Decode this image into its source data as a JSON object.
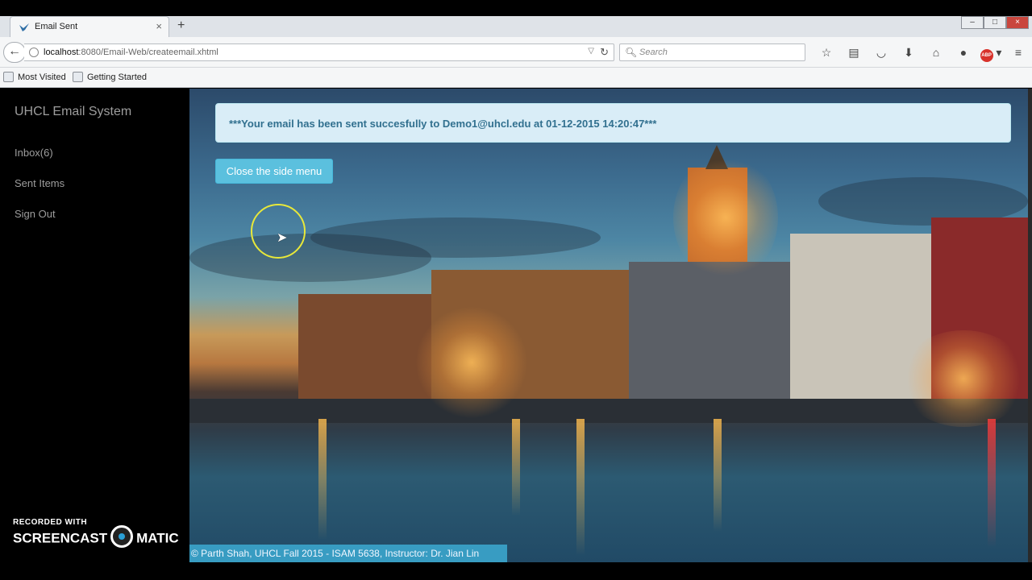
{
  "browser": {
    "tab_title": "Email Sent",
    "tab_close": "×",
    "new_tab": "+",
    "url_host": "localhost",
    "url_rest": ":8080/Email-Web/createemail.xhtml",
    "search_placeholder": "Search",
    "bookmarks": [
      "Most Visited",
      "Getting Started"
    ],
    "icons": [
      "back-icon",
      "star-icon",
      "reading-list-icon",
      "pocket-icon",
      "download-icon",
      "home-icon",
      "chat-icon",
      "adblock-icon",
      "menu-icon"
    ],
    "abp_label": "ABP"
  },
  "sidebar": {
    "brand": "UHCL Email System",
    "items": [
      "Inbox(6)",
      "Sent Items",
      "Sign Out"
    ]
  },
  "main": {
    "alert": "***Your email has been sent succesfully to Demo1@uhcl.edu at 01-12-2015 14:20:47***",
    "close_menu_button": "Close the side menu"
  },
  "footer": {
    "text": "© Parth Shah, UHCL Fall 2015 - ISAM 5638, Instructor: Dr. Jian Lin"
  },
  "watermark": {
    "line1": "RECORDED WITH",
    "line2_left": "SCREENCAST",
    "line2_right": "MATIC"
  },
  "colors": {
    "alert_bg": "#d9edf7",
    "alert_text": "#31708f",
    "button_bg": "#5bc0de",
    "sidebar_bg": "#000000"
  }
}
